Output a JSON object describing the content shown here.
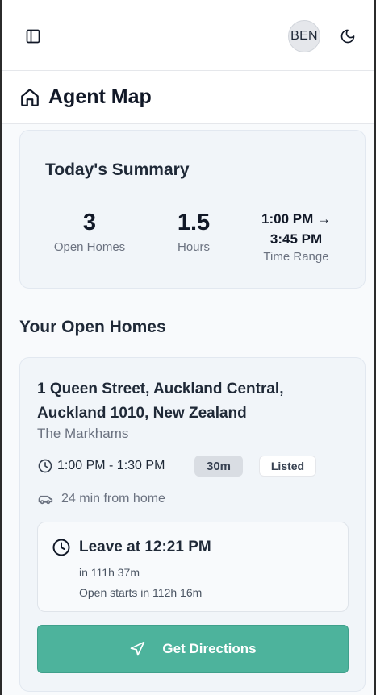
{
  "header": {
    "user_initials": "BEN",
    "icons": {
      "sidebar_toggle": "sidebar-icon",
      "theme_toggle": "moon-icon"
    }
  },
  "page": {
    "title": "Agent Map",
    "icon": "home-icon"
  },
  "summary": {
    "title": "Today's Summary",
    "open_homes": {
      "value": "3",
      "label": "Open Homes"
    },
    "hours": {
      "value": "1.5",
      "label": "Hours"
    },
    "time_range": {
      "start": "1:00 PM →",
      "end": "3:45 PM",
      "label": "Time Range"
    }
  },
  "open_homes_section": {
    "title": "Your Open Homes",
    "items": [
      {
        "address": "1 Queen Street, Auckland Central, Auckland 1010, New Zealand",
        "vendor": "The Markhams",
        "time": "1:00 PM - 1:30 PM",
        "duration": "30m",
        "status": "Listed",
        "travel": "24 min from home",
        "leave_at": "Leave at 12:21 PM",
        "leave_in": "in 111h 37m",
        "open_starts": "Open starts in 112h 16m",
        "directions_label": "Get Directions"
      }
    ]
  },
  "colors": {
    "accent": "#4db39c",
    "background": "#f8fafc",
    "card": "#f1f5f9"
  }
}
